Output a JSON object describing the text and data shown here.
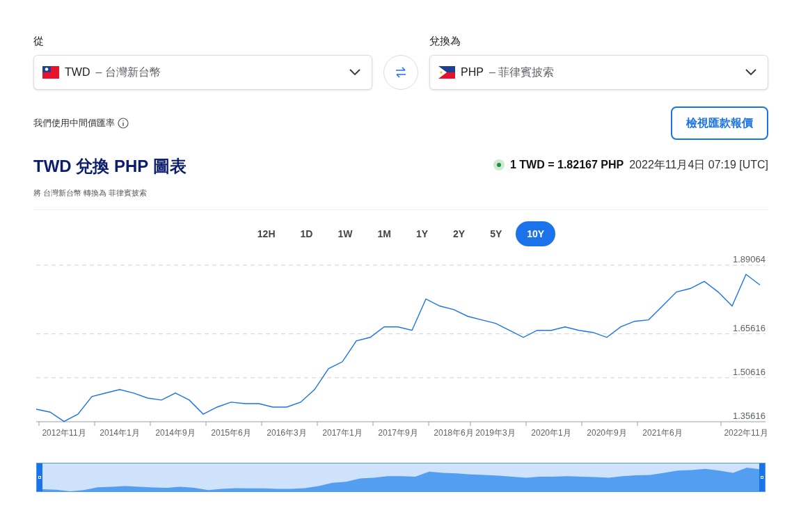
{
  "from": {
    "label": "從",
    "code": "TWD",
    "name": "– 台灣新台幣"
  },
  "to": {
    "label": "兌換為",
    "code": "PHP",
    "name": "– 菲律賓披索"
  },
  "rate_note": "我們使用中間價匯率",
  "quote_button": "檢視匯款報價",
  "chart_title": "TWD 兌換 PHP 圖表",
  "chart_subtitle": "將 台灣新台幣 轉換為 菲律賓披索",
  "live_rate": "1 TWD = 1.82167 PHP",
  "timestamp": "2022年11月4日 07:19 [UTC]",
  "ranges": [
    {
      "label": "12H",
      "selected": false
    },
    {
      "label": "1D",
      "selected": false
    },
    {
      "label": "1W",
      "selected": false
    },
    {
      "label": "1M",
      "selected": false
    },
    {
      "label": "1Y",
      "selected": false
    },
    {
      "label": "2Y",
      "selected": false
    },
    {
      "label": "5Y",
      "selected": false
    },
    {
      "label": "10Y",
      "selected": true
    }
  ],
  "chart_data": {
    "type": "line",
    "ylim": [
      1.35616,
      1.89064
    ],
    "yticks": [
      1.35616,
      1.50616,
      1.65616,
      1.89064
    ],
    "categories": [
      null,
      null,
      "2012年11月",
      null,
      null,
      null,
      "2014年1月",
      null,
      null,
      null,
      "2014年9月",
      null,
      null,
      null,
      "2015年6月",
      null,
      null,
      null,
      "2016年3月",
      null,
      null,
      null,
      "2017年1月",
      null,
      null,
      null,
      "2017年9月",
      null,
      null,
      null,
      "2018年6月",
      null,
      null,
      "2019年3月",
      null,
      null,
      null,
      "2020年1月",
      null,
      null,
      null,
      "2020年9月",
      null,
      null,
      null,
      "2021年6月",
      null,
      null,
      null,
      null,
      null,
      "2022年11月",
      null
    ],
    "series": [
      {
        "color": "#1a73e8",
        "values": [
          1.399,
          1.389,
          1.357,
          1.382,
          1.442,
          1.454,
          1.466,
          1.454,
          1.437,
          1.43,
          1.454,
          1.43,
          1.382,
          1.406,
          1.423,
          1.418,
          1.418,
          1.406,
          1.406,
          1.423,
          1.466,
          1.537,
          1.561,
          1.632,
          1.644,
          1.68,
          1.68,
          1.668,
          1.775,
          1.751,
          1.739,
          1.716,
          1.704,
          1.692,
          1.668,
          1.644,
          1.668,
          1.668,
          1.68,
          1.668,
          1.661,
          1.644,
          1.68,
          1.699,
          1.704,
          1.751,
          1.799,
          1.811,
          1.835,
          1.799,
          1.751,
          1.859,
          1.823
        ]
      }
    ]
  }
}
